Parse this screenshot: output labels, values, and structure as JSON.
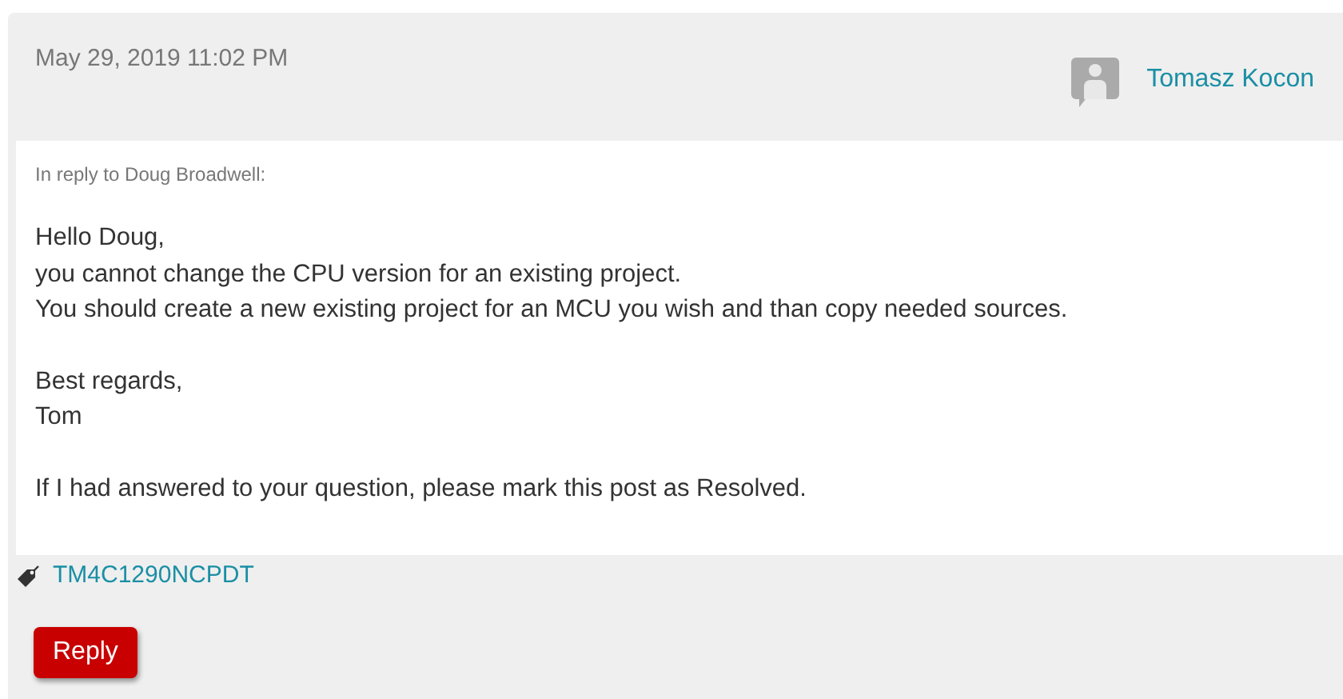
{
  "post": {
    "date": "May 29, 2019 11:02 PM",
    "author": "Tomasz Kocon"
  },
  "body": {
    "in_reply_to": "In reply to Doug Broadwell:",
    "paragraphs": [
      [
        "Hello Doug,",
        "you cannot change the CPU version for an existing project.",
        "You should create a new existing project for an MCU you wish and than copy needed sources."
      ],
      [
        "Best regards,",
        "Tom"
      ],
      [
        "If I had answered to your question, please mark this post as Resolved."
      ]
    ]
  },
  "tags": [
    "TM4C1290NCPDT"
  ],
  "reply_button": "Reply"
}
